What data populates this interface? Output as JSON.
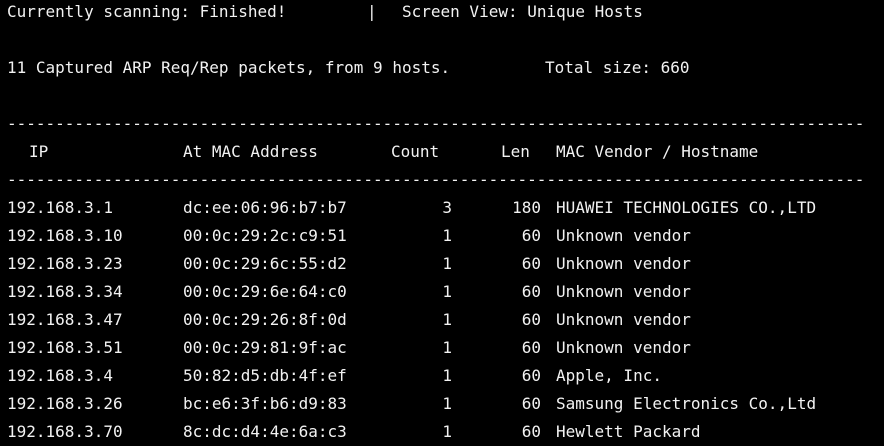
{
  "status": {
    "scanning_label": "Currently scanning: Finished!",
    "separator": "|",
    "view_label": "Screen View: Unique Hosts"
  },
  "summary": {
    "captured": "11 Captured ARP Req/Rep packets, from 9 hosts.",
    "total_size": "Total size: 660"
  },
  "separator_line": "-----------------------------------------------------------------------------------------",
  "table": {
    "headers": {
      "ip": "IP",
      "mac": "At MAC Address",
      "count": "Count",
      "len": "Len",
      "vendor": "MAC Vendor / Hostname"
    },
    "rows": [
      {
        "ip": "192.168.3.1",
        "mac": "dc:ee:06:96:b7:b7",
        "count": "3",
        "len": "180",
        "vendor": "HUAWEI TECHNOLOGIES CO.,LTD"
      },
      {
        "ip": "192.168.3.10",
        "mac": "00:0c:29:2c:c9:51",
        "count": "1",
        "len": "60",
        "vendor": "Unknown vendor"
      },
      {
        "ip": "192.168.3.23",
        "mac": "00:0c:29:6c:55:d2",
        "count": "1",
        "len": "60",
        "vendor": "Unknown vendor"
      },
      {
        "ip": "192.168.3.34",
        "mac": "00:0c:29:6e:64:c0",
        "count": "1",
        "len": "60",
        "vendor": "Unknown vendor"
      },
      {
        "ip": "192.168.3.47",
        "mac": "00:0c:29:26:8f:0d",
        "count": "1",
        "len": "60",
        "vendor": "Unknown vendor"
      },
      {
        "ip": "192.168.3.51",
        "mac": "00:0c:29:81:9f:ac",
        "count": "1",
        "len": "60",
        "vendor": "Unknown vendor"
      },
      {
        "ip": "192.168.3.4",
        "mac": "50:82:d5:db:4f:ef",
        "count": "1",
        "len": "60",
        "vendor": "Apple, Inc."
      },
      {
        "ip": "192.168.3.26",
        "mac": "bc:e6:3f:b6:d9:83",
        "count": "1",
        "len": "60",
        "vendor": "Samsung Electronics Co.,Ltd"
      },
      {
        "ip": "192.168.3.70",
        "mac": "8c:dc:d4:4e:6a:c3",
        "count": "1",
        "len": "60",
        "vendor": "Hewlett Packard"
      }
    ]
  }
}
